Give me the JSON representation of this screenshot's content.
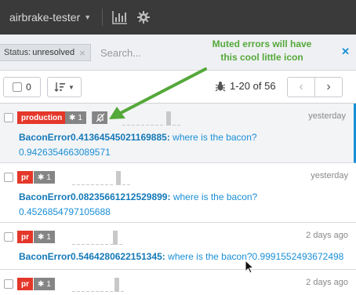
{
  "topbar": {
    "project_name": "airbrake-tester",
    "caret_icon": "caret-down-icon",
    "chart_icon": "bar-chart-icon",
    "settings_icon": "gear-icon"
  },
  "filter": {
    "status_label": "Status:",
    "status_value": "unresolved",
    "search_placeholder": "Search...",
    "clear_icon": "close-icon"
  },
  "annotation": {
    "line1": "Muted errors will have",
    "line2": "this cool little icon",
    "color": "#55a83a"
  },
  "toolbar": {
    "selected_count": "0",
    "pager_text": "1-20 of 56",
    "prev_label": "‹",
    "next_label": "›"
  },
  "colors": {
    "accent": "#1a8fd6",
    "env_badge": "#e4372a",
    "count_badge": "#858585"
  },
  "errors": [
    {
      "env": "production",
      "count": "1",
      "muted": true,
      "when": "yesterday",
      "error_class": "BaconError0.41364545021169885:",
      "message": " where is the bacon?",
      "message2": "0.9426354663089571"
    },
    {
      "env": "pr",
      "count": "1",
      "muted": false,
      "when": "yesterday",
      "error_class": "BaconError0.08235661212529899:",
      "message": " where is the bacon?",
      "message2": "0.4526854797105688"
    },
    {
      "env": "pr",
      "count": "1",
      "muted": false,
      "when": "2 days ago",
      "error_class": "BaconError0.5464280622151345:",
      "message": " where is the bacon?0.9991552493672498",
      "message2": ""
    },
    {
      "env": "pr",
      "count": "1",
      "muted": false,
      "when": "2 days ago",
      "error_class": "",
      "message": "",
      "message2": ""
    }
  ]
}
